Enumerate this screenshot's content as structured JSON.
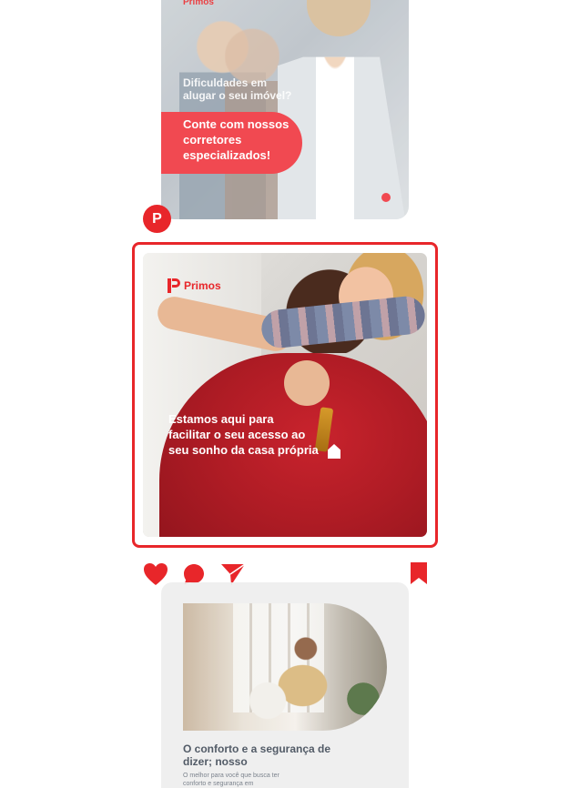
{
  "top_post": {
    "brand": "Primos",
    "question": "Dificuldades em alugar o seu imóvel?",
    "cta": "Conte com nossos corretores especializados!"
  },
  "profile": {
    "avatar_icon": "primos-logo-icon",
    "avatar_letter": "P"
  },
  "main_post": {
    "brand": "Primos",
    "headline": "Estamos aqui para facilitar o seu acesso ao seu sonho da casa própria"
  },
  "actions": {
    "like_icon": "heart-icon",
    "comment_icon": "comment-icon",
    "share_icon": "send-icon",
    "save_icon": "bookmark-icon"
  },
  "bottom_post": {
    "title": "O conforto e a segurança de dizer; nosso",
    "body": "O melhor para você que busca ter conforto e segurança em"
  },
  "colors": {
    "brand_red": "#e8262a",
    "accent_red": "#f0313a"
  }
}
